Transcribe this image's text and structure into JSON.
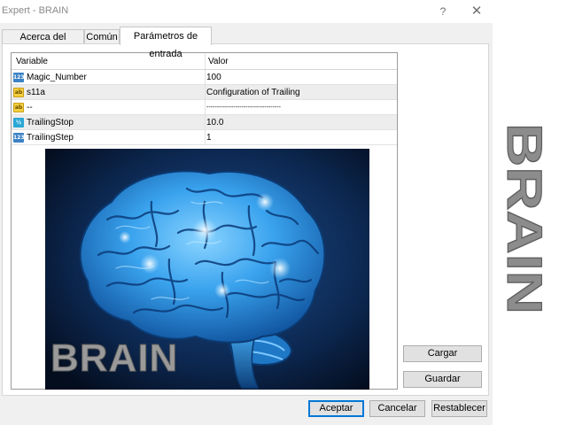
{
  "window": {
    "title": "Expert - BRAIN",
    "help_glyph": "?",
    "close_glyph": "✕"
  },
  "tabs": [
    {
      "label": "Acerca del programa"
    },
    {
      "label": "Común"
    },
    {
      "label": "Parámetros de entrada",
      "active": true
    }
  ],
  "table": {
    "headers": {
      "variable": "Variable",
      "value": "Valor"
    },
    "rows": [
      {
        "icon": "integer-type-icon",
        "icon_text": "123",
        "variable": "Magic_Number",
        "value": "100"
      },
      {
        "icon": "string-type-icon",
        "icon_text": "ab",
        "variable": "s11a",
        "value": "Configuration of Trailing"
      },
      {
        "icon": "string-type-icon",
        "icon_text": "ab",
        "variable": "--",
        "value": "------------------------------------"
      },
      {
        "icon": "double-type-icon",
        "icon_text": "½",
        "variable": "TrailingStop",
        "value": "10.0"
      },
      {
        "icon": "integer-type-icon",
        "icon_text": "123",
        "variable": "TrailingStep",
        "value": "1"
      }
    ]
  },
  "picture": {
    "caption": "BRAIN",
    "palette": {
      "bg": "#0a1f3d",
      "brain": "#3fa8f0",
      "highlight": "#bfe8ff"
    }
  },
  "side_buttons": {
    "load": "Cargar",
    "save": "Guardar"
  },
  "footer_buttons": {
    "accept": "Aceptar",
    "cancel": "Cancelar",
    "reset": "Restablecer"
  },
  "side_word": "BRAIN",
  "colors": {
    "accent": "#0078d7",
    "dialog_bg": "#f0f0f0"
  }
}
